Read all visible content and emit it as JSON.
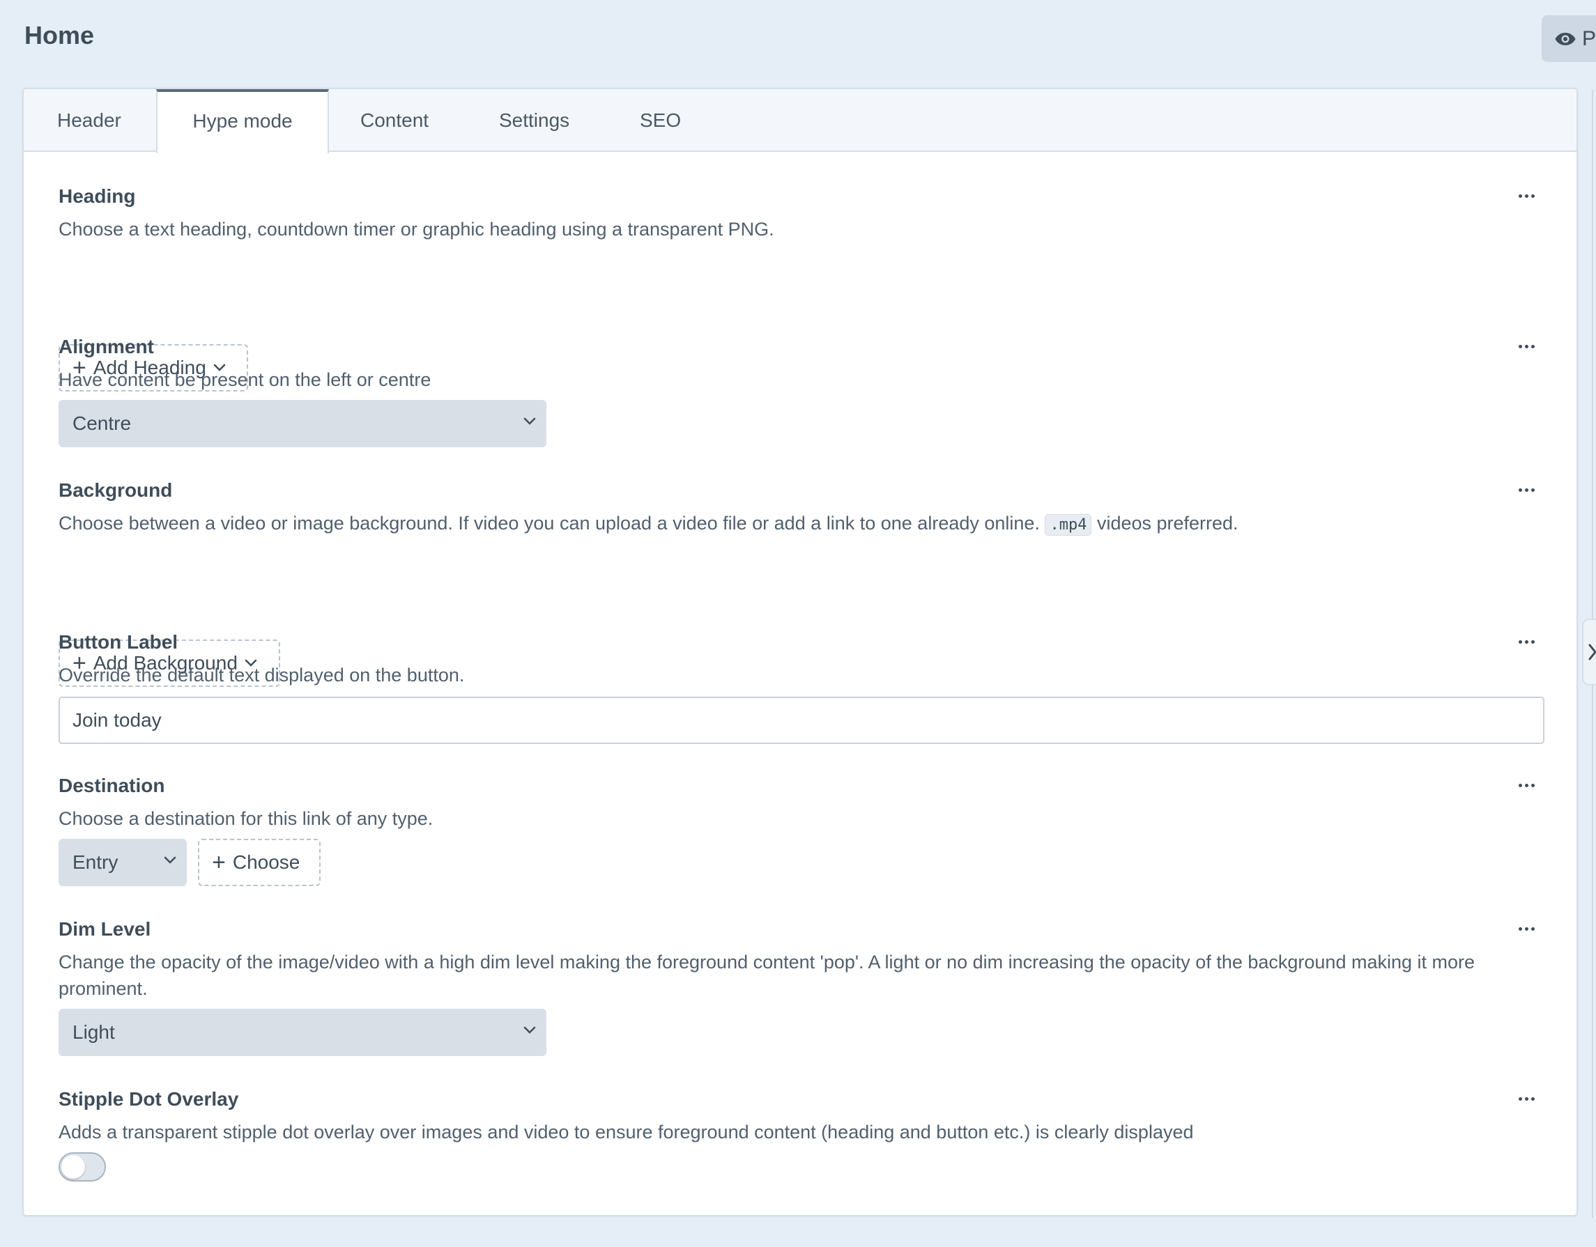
{
  "page": {
    "title": "Home"
  },
  "preview": {
    "label": "Preview"
  },
  "tabs": [
    {
      "label": "Header",
      "active": false
    },
    {
      "label": "Hype mode",
      "active": true
    },
    {
      "label": "Content",
      "active": false
    },
    {
      "label": "Settings",
      "active": false
    },
    {
      "label": "SEO",
      "active": false
    }
  ],
  "fields": {
    "heading": {
      "label": "Heading",
      "description": "Choose a text heading, countdown timer or graphic heading using a transparent PNG.",
      "button": "Add Heading"
    },
    "alignment": {
      "label": "Alignment",
      "description": "Have content be present on the left or centre",
      "value": "Centre"
    },
    "background": {
      "label": "Background",
      "description_before": "Choose between a video or image background. If video you can upload a video file or add a link to one already online.",
      "code": ".mp4",
      "description_after": "videos preferred.",
      "button": "Add Background"
    },
    "button_label": {
      "label": "Button Label",
      "description": "Override the default text displayed on the button.",
      "value": "Join today"
    },
    "destination": {
      "label": "Destination",
      "description": "Choose a destination for this link of any type.",
      "type_value": "Entry",
      "button": "Choose"
    },
    "dim_level": {
      "label": "Dim Level",
      "description": "Change the opacity of the image/video with a high dim level making the foreground content 'pop'. A light or no dim increasing the opacity of the background making it more prominent.",
      "value": "Light"
    },
    "stipple": {
      "label": "Stipple Dot Overlay",
      "description": "Adds a transparent stipple dot overlay over images and video to ensure foreground content (heading and button etc.) is clearly displayed",
      "enabled": false
    }
  }
}
